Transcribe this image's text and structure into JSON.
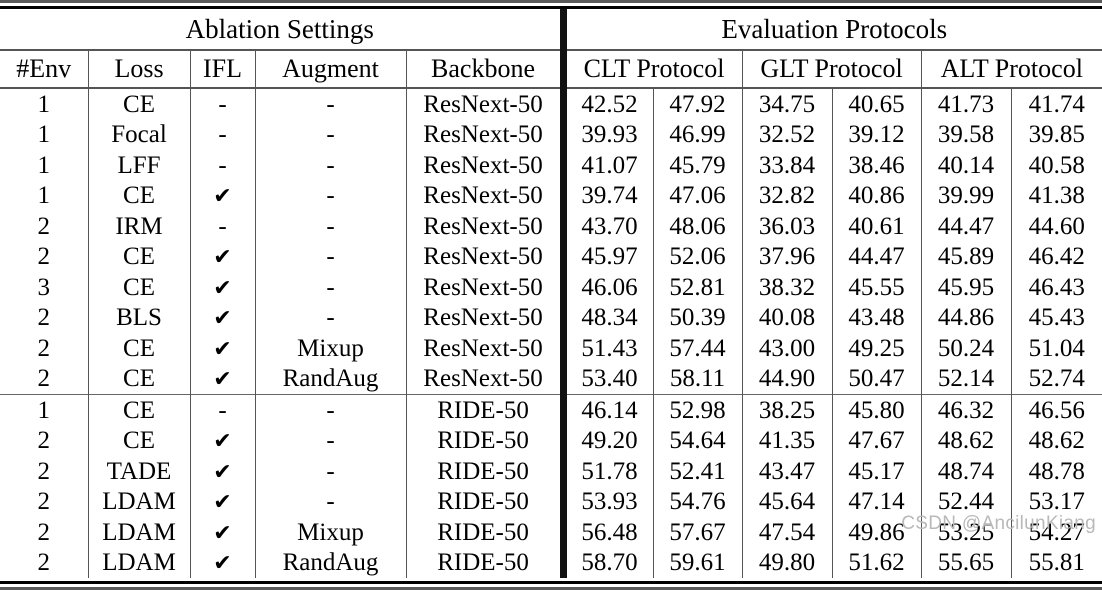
{
  "table": {
    "group_headers": [
      {
        "label": "Ablation Settings",
        "span": 5
      },
      {
        "label": "Evaluation Protocols",
        "span": 6
      }
    ],
    "column_headers": [
      {
        "label": "#Env",
        "span": 1
      },
      {
        "label": "Loss",
        "span": 1
      },
      {
        "label": "IFL",
        "span": 1
      },
      {
        "label": "Augment",
        "span": 1
      },
      {
        "label": "Backbone",
        "span": 1
      },
      {
        "label": "CLT Protocol",
        "span": 2
      },
      {
        "label": "GLT Protocol",
        "span": 2
      },
      {
        "label": "ALT Protocol",
        "span": 2
      }
    ],
    "check_glyph": "✔",
    "dash_glyph": "-",
    "sections": [
      {
        "name": "resnext-section",
        "rows": [
          {
            "env": "1",
            "loss": "CE",
            "ifl": "-",
            "augment": "-",
            "backbone": "ResNext-50",
            "clt": [
              "42.52",
              "47.92"
            ],
            "glt": [
              "34.75",
              "40.65"
            ],
            "alt": [
              "41.73",
              "41.74"
            ],
            "bold": false
          },
          {
            "env": "1",
            "loss": "Focal",
            "ifl": "-",
            "augment": "-",
            "backbone": "ResNext-50",
            "clt": [
              "39.93",
              "46.99"
            ],
            "glt": [
              "32.52",
              "39.12"
            ],
            "alt": [
              "39.58",
              "39.85"
            ],
            "bold": false
          },
          {
            "env": "1",
            "loss": "LFF",
            "ifl": "-",
            "augment": "-",
            "backbone": "ResNext-50",
            "clt": [
              "41.07",
              "45.79"
            ],
            "glt": [
              "33.84",
              "38.46"
            ],
            "alt": [
              "40.14",
              "40.58"
            ],
            "bold": false
          },
          {
            "env": "1",
            "loss": "CE",
            "ifl": "✔",
            "augment": "-",
            "backbone": "ResNext-50",
            "clt": [
              "39.74",
              "47.06"
            ],
            "glt": [
              "32.82",
              "40.86"
            ],
            "alt": [
              "39.99",
              "41.38"
            ],
            "bold": false
          },
          {
            "env": "2",
            "loss": "IRM",
            "ifl": "-",
            "augment": "-",
            "backbone": "ResNext-50",
            "clt": [
              "43.70",
              "48.06"
            ],
            "glt": [
              "36.03",
              "40.61"
            ],
            "alt": [
              "44.47",
              "44.60"
            ],
            "bold": false
          },
          {
            "env": "2",
            "loss": "CE",
            "ifl": "✔",
            "augment": "-",
            "backbone": "ResNext-50",
            "clt": [
              "45.97",
              "52.06"
            ],
            "glt": [
              "37.96",
              "44.47"
            ],
            "alt": [
              "45.89",
              "46.42"
            ],
            "bold": false
          },
          {
            "env": "3",
            "loss": "CE",
            "ifl": "✔",
            "augment": "-",
            "backbone": "ResNext-50",
            "clt": [
              "46.06",
              "52.81"
            ],
            "glt": [
              "38.32",
              "45.55"
            ],
            "alt": [
              "45.95",
              "46.43"
            ],
            "bold": false
          },
          {
            "env": "2",
            "loss": "BLS",
            "ifl": "✔",
            "augment": "-",
            "backbone": "ResNext-50",
            "clt": [
              "48.34",
              "50.39"
            ],
            "glt": [
              "40.08",
              "43.48"
            ],
            "alt": [
              "44.86",
              "45.43"
            ],
            "bold": false
          },
          {
            "env": "2",
            "loss": "CE",
            "ifl": "✔",
            "augment": "Mixup",
            "backbone": "ResNext-50",
            "clt": [
              "51.43",
              "57.44"
            ],
            "glt": [
              "43.00",
              "49.25"
            ],
            "alt": [
              "50.24",
              "51.04"
            ],
            "bold": false
          },
          {
            "env": "2",
            "loss": "CE",
            "ifl": "✔",
            "augment": "RandAug",
            "backbone": "ResNext-50",
            "clt": [
              "53.40",
              "58.11"
            ],
            "glt": [
              "44.90",
              "50.47"
            ],
            "alt": [
              "52.14",
              "52.74"
            ],
            "bold": true
          }
        ]
      },
      {
        "name": "ride-section",
        "rows": [
          {
            "env": "1",
            "loss": "CE",
            "ifl": "-",
            "augment": "-",
            "backbone": "RIDE-50",
            "clt": [
              "46.14",
              "52.98"
            ],
            "glt": [
              "38.25",
              "45.80"
            ],
            "alt": [
              "46.32",
              "46.56"
            ],
            "bold": false
          },
          {
            "env": "2",
            "loss": "CE",
            "ifl": "✔",
            "augment": "-",
            "backbone": "RIDE-50",
            "clt": [
              "49.20",
              "54.64"
            ],
            "glt": [
              "41.35",
              "47.67"
            ],
            "alt": [
              "48.62",
              "48.62"
            ],
            "bold": false
          },
          {
            "env": "2",
            "loss": "TADE",
            "ifl": "✔",
            "augment": "-",
            "backbone": "RIDE-50",
            "clt": [
              "51.78",
              "52.41"
            ],
            "glt": [
              "43.47",
              "45.17"
            ],
            "alt": [
              "48.74",
              "48.78"
            ],
            "bold": false
          },
          {
            "env": "2",
            "loss": "LDAM",
            "ifl": "✔",
            "augment": "-",
            "backbone": "RIDE-50",
            "clt": [
              "53.93",
              "54.76"
            ],
            "glt": [
              "45.64",
              "47.14"
            ],
            "alt": [
              "52.44",
              "53.17"
            ],
            "bold": false
          },
          {
            "env": "2",
            "loss": "LDAM",
            "ifl": "✔",
            "augment": "Mixup",
            "backbone": "RIDE-50",
            "clt": [
              "56.48",
              "57.67"
            ],
            "glt": [
              "47.54",
              "49.86"
            ],
            "alt": [
              "53.25",
              "54.27"
            ],
            "bold": false
          },
          {
            "env": "2",
            "loss": "LDAM",
            "ifl": "✔",
            "augment": "RandAug",
            "backbone": "RIDE-50",
            "clt": [
              "58.70",
              "59.61"
            ],
            "glt": [
              "49.80",
              "51.62"
            ],
            "alt": [
              "55.65",
              "55.81"
            ],
            "bold": true
          }
        ]
      }
    ]
  },
  "watermark": {
    "text": "CSDN @AncilunKiang"
  },
  "colors": {
    "rule": "#555555",
    "text": "#000000",
    "watermark": "#b9b9b9",
    "background": "#ffffff"
  }
}
